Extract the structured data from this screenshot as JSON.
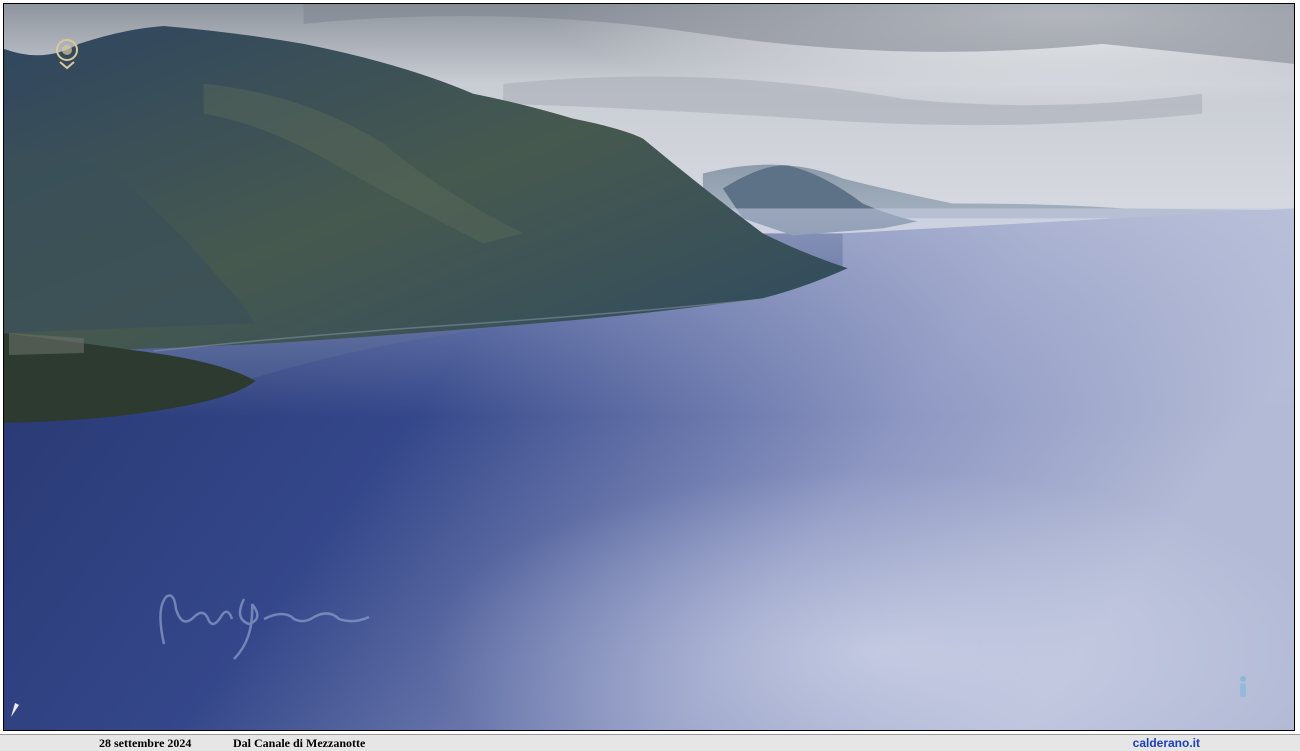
{
  "photo": {
    "subject": "",
    "colors": {
      "sky": "#cfd3da",
      "mountain": "#3e5560",
      "sea_deep": "#2f3f7d",
      "sea_glare": "#aab2d2"
    }
  },
  "footer": {
    "date": "28 settembre 2024",
    "caption": "Dal Canale di Mezzanotte",
    "site": "calderano.it"
  }
}
